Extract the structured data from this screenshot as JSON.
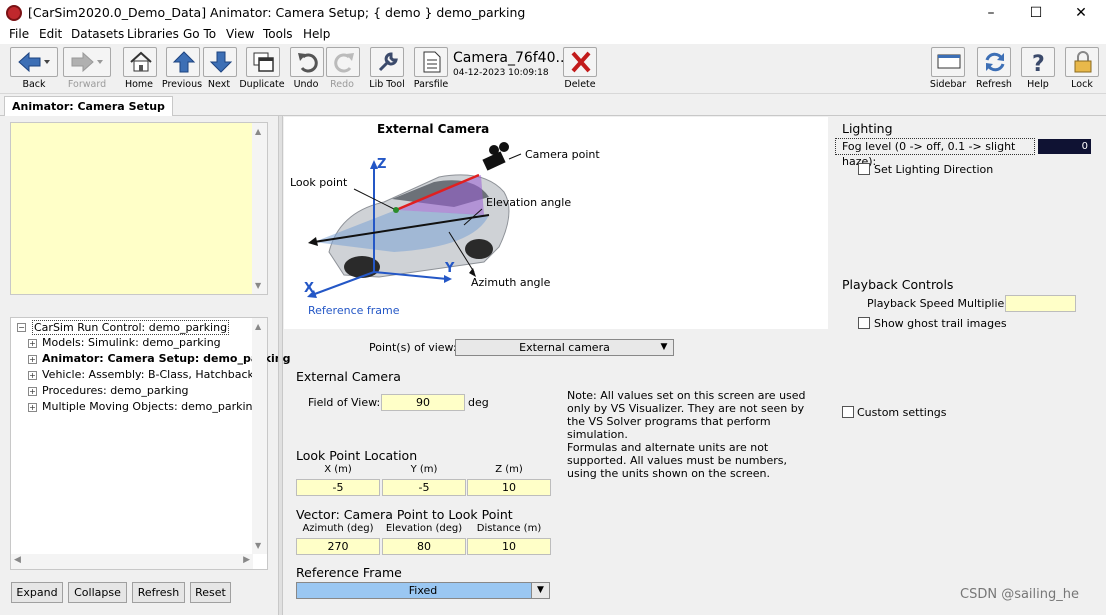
{
  "window": {
    "title": "[CarSim2020.0_Demo_Data] Animator: Camera Setup; { demo } demo_parking",
    "controls": [
      "–",
      "☐",
      "✕"
    ]
  },
  "menu": [
    "File",
    "Edit",
    "Datasets",
    "Libraries",
    "Go To",
    "View",
    "Tools",
    "Help"
  ],
  "toolbar": {
    "back": "Back",
    "forward": "Forward",
    "home": "Home",
    "previous": "Previous",
    "next": "Next",
    "duplicate": "Duplicate",
    "undo": "Undo",
    "redo": "Redo",
    "lib_tool": "Lib Tool",
    "parsfile": "Parsfile",
    "dataset_name": "Camera_76f40..",
    "dataset_date": "04-12-2023 10:09:18",
    "delete": "Delete",
    "sidebar": "Sidebar",
    "refresh": "Refresh",
    "help": "Help",
    "lock": "Lock"
  },
  "tab": {
    "label": "Animator: Camera Setup"
  },
  "tree": {
    "root": "CarSim Run Control: demo_parking",
    "items": [
      "Models: Simulink: demo_parking",
      "Animator: Camera Setup: demo_parking",
      "Vehicle: Assembly: B-Class, Hatchback",
      "Procedures: demo_parking",
      "Multiple Moving Objects: demo_parking"
    ]
  },
  "left_buttons": {
    "expand": "Expand",
    "collapse": "Collapse",
    "refresh": "Refresh",
    "reset": "Reset"
  },
  "diagram": {
    "title": "External Camera",
    "camera_point": "Camera point",
    "look_point": "Look point",
    "elevation_angle": "Elevation angle",
    "azimuth_angle": "Azimuth angle",
    "reference_frame": "Reference frame",
    "axis_z": "Z",
    "axis_y": "Y",
    "axis_x": "X"
  },
  "points_of_view": {
    "label": "Point(s) of view:",
    "value": "External camera"
  },
  "external_camera": {
    "title": "External Camera",
    "fov_label": "Field of View:",
    "fov_value": "90",
    "fov_unit": "deg"
  },
  "note": {
    "p1": "Note: All values set on this screen are used only by VS Visualizer. They are not seen by the VS Solver programs that perform simulation.",
    "p2": "Formulas and alternate units are not supported. All values must be numbers, using the units shown on the screen."
  },
  "look_point": {
    "title": "Look Point Location",
    "headers": [
      "X (m)",
      "Y (m)",
      "Z (m)"
    ],
    "values": [
      "-5",
      "-5",
      "10"
    ]
  },
  "vector": {
    "title": "Vector: Camera Point to Look Point",
    "headers": [
      "Azimuth (deg)",
      "Elevation (deg)",
      "Distance (m)"
    ],
    "values": [
      "270",
      "80",
      "10"
    ]
  },
  "reference_frame": {
    "title": "Reference Frame",
    "value": "Fixed"
  },
  "lighting": {
    "title": "Lighting",
    "fog_label": "Fog level (0 -> off, 0.1 -> slight haze):",
    "fog_value": "0",
    "set_direction": "Set Lighting Direction"
  },
  "playback": {
    "title": "Playback Controls",
    "speed_label": "Playback Speed Multiplier:",
    "speed_value": "",
    "ghost_trail": "Show ghost trail images"
  },
  "custom_settings": "Custom settings",
  "watermark": "CSDN @sailing_he"
}
